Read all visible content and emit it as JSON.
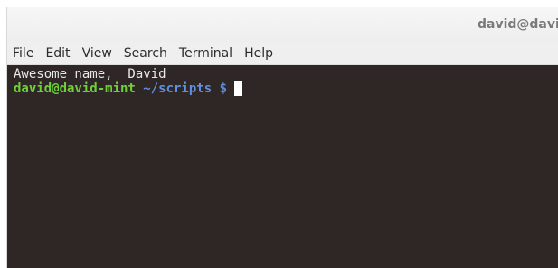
{
  "window": {
    "title": "david@davi"
  },
  "menu": {
    "items": [
      "File",
      "Edit",
      "View",
      "Search",
      "Terminal",
      "Help"
    ]
  },
  "terminal": {
    "output_line": "Awesome name,  David",
    "prompt_user_host": "david@david-mint",
    "prompt_path": " ~/scripts $ ",
    "colors": {
      "background": "#2f2725",
      "text": "#e8e8e8",
      "user_host": "#6ed13a",
      "path": "#5f8fe0"
    }
  }
}
